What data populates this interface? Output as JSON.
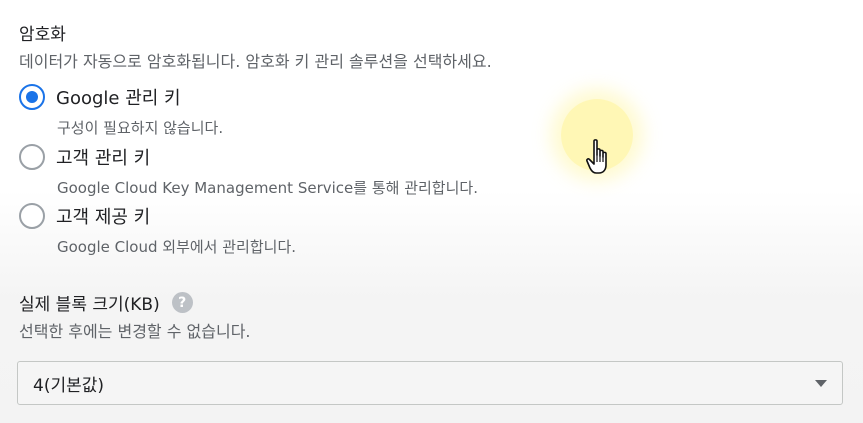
{
  "encryption": {
    "title": "암호화",
    "description": "데이터가 자동으로 암호화됩니다. 암호화 키 관리 솔루션을 선택하세요.",
    "options": [
      {
        "label": "Google 관리 키",
        "description": "구성이 필요하지 않습니다.",
        "selected": true
      },
      {
        "label": "고객 관리 키",
        "description": "Google Cloud Key Management Service를 통해 관리합니다.",
        "selected": false
      },
      {
        "label": "고객 제공 키",
        "description": "Google Cloud 외부에서 관리합니다.",
        "selected": false
      }
    ]
  },
  "block_size": {
    "title": "실제 블록 크기(KB)",
    "help_icon": "help-icon",
    "help_glyph": "?",
    "description": "선택한 후에는 변경할 수 없습니다.",
    "selected_value": "4(기본값)"
  },
  "colors": {
    "accent": "#1a73e8",
    "cursor_highlight": "#fff078"
  }
}
